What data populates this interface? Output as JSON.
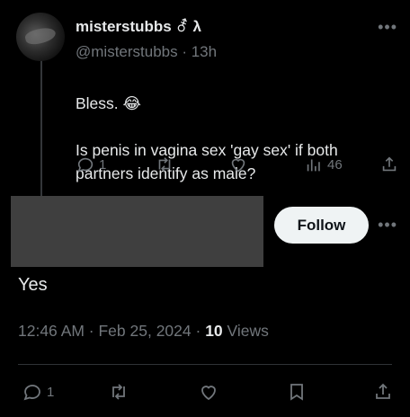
{
  "tweet": {
    "display_name": "misterstubbs",
    "name_badge": "⚦ λ",
    "handle_time": "@misterstubbs · 13h",
    "line1": "Bless. 😂",
    "line2": "Is penis in vagina sex 'gay sex' if both partners identify as male?",
    "reply_count": "1",
    "views_count": "46"
  },
  "reply": {
    "follow_label": "Follow",
    "text": "Yes",
    "time_date": "12:46 AM · Feb 25, 2024 · ",
    "views_number": "10",
    "views_label": " Views",
    "reply_count": "1"
  },
  "icons": [
    "reply-icon",
    "retweet-icon",
    "like-icon",
    "views-icon",
    "share-icon",
    "bookmark-icon",
    "more-icon"
  ],
  "colors": {
    "background": "#000000",
    "text": "#e7e9ea",
    "muted": "#71767b",
    "follow_bg": "#eff3f4"
  }
}
